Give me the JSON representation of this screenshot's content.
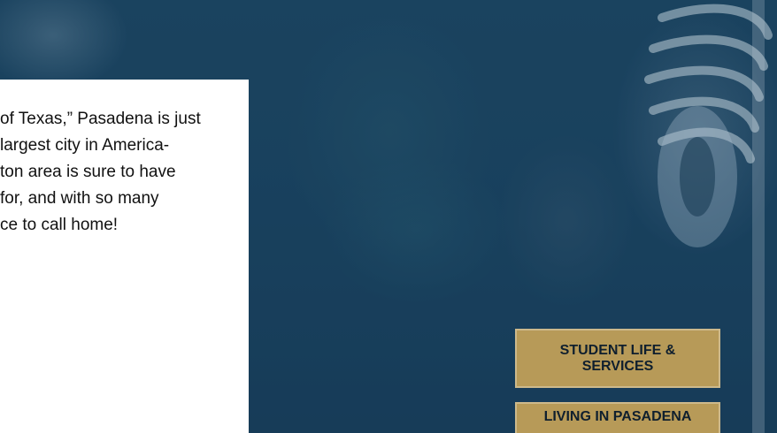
{
  "intro": {
    "lines": [
      "of Texas,” Pasadena is just",
      "largest city in America-",
      "ton area is sure to have",
      "for, and with so many",
      "ce to call home!"
    ]
  },
  "buttons": {
    "student_life": "STUDENT LIFE & SERVICES",
    "living": "LIVING IN PASADENA"
  },
  "colors": {
    "overlay_blue": "#1c4560",
    "button_gold": "#b79a58",
    "card_white": "#ffffff"
  }
}
